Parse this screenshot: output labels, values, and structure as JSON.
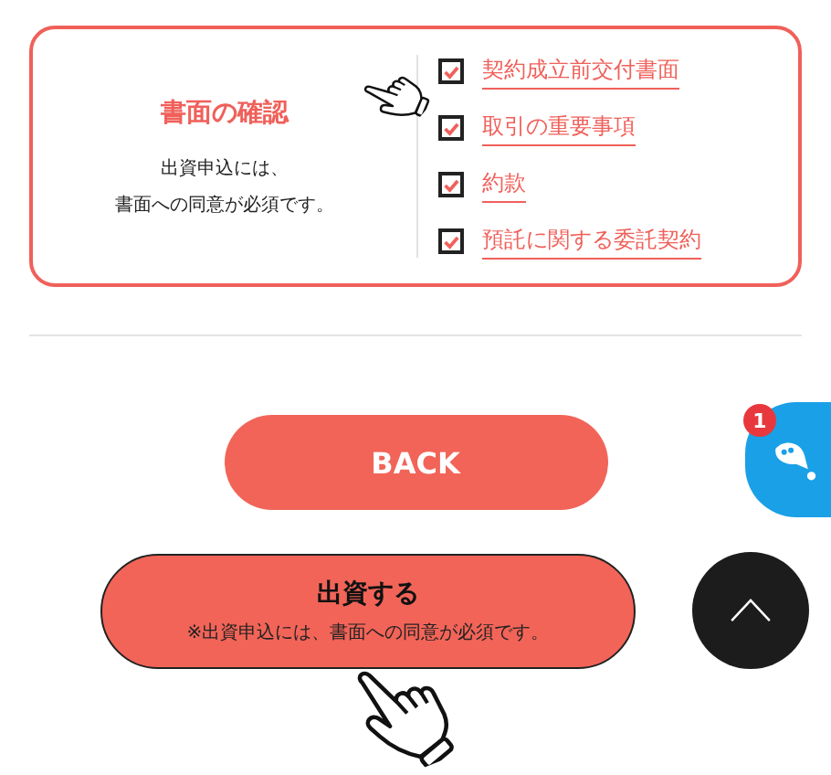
{
  "consent_card": {
    "title": "書面の確認",
    "description": [
      "出資申込には、",
      "書面への同意が必須です。"
    ],
    "documents": [
      {
        "label": "契約成立前交付書面",
        "checked": true
      },
      {
        "label": "取引の重要事項",
        "checked": true
      },
      {
        "label": "約款",
        "checked": true
      },
      {
        "label": "預託に関する委託契約",
        "checked": true
      }
    ]
  },
  "back_button": "BACK",
  "submit_button": {
    "label": "出資する",
    "note": "※出資申込には、書面への同意が必須です。"
  },
  "chat_badge": "1"
}
